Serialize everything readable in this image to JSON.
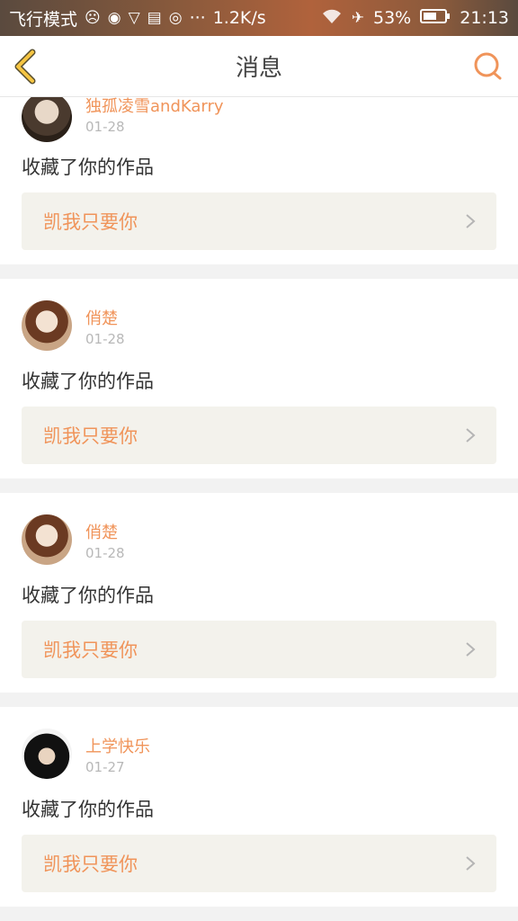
{
  "status_bar": {
    "mode_label": "飞行模式",
    "speed": "1.2K/s",
    "more": "···",
    "battery": "53%",
    "time": "21:13"
  },
  "header": {
    "title": "消息"
  },
  "notifications": [
    {
      "username": "独孤凌雪andKarry",
      "date": "01-28",
      "action": "收藏了你的作品",
      "work_title": "凯我只要你"
    },
    {
      "username": "俏楚",
      "date": "01-28",
      "action": "收藏了你的作品",
      "work_title": "凯我只要你"
    },
    {
      "username": "俏楚",
      "date": "01-28",
      "action": "收藏了你的作品",
      "work_title": "凯我只要你"
    },
    {
      "username": "上学快乐",
      "date": "01-27",
      "action": "收藏了你的作品",
      "work_title": "凯我只要你"
    }
  ],
  "colors": {
    "accent": "#f0945a",
    "back_icon": "#f5c542",
    "work_box_bg": "#f3f2ec"
  },
  "icons": {
    "back": "chevron-left-icon",
    "search": "search-icon",
    "item_arrow": "chevron-right-icon"
  }
}
